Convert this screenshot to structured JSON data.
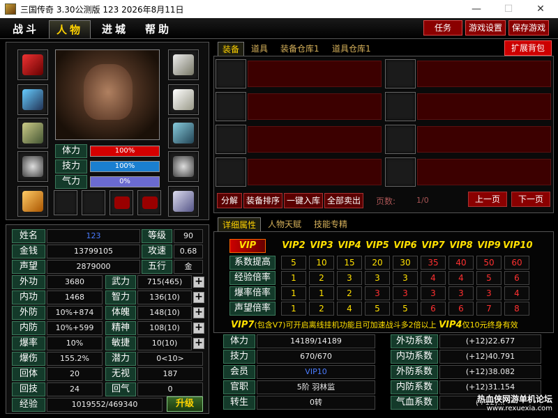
{
  "window": {
    "title": "三国传奇 3.30公测版 123   2026年8月11日",
    "controls": [
      "—",
      "☐",
      "✕"
    ]
  },
  "menu": {
    "tabs": [
      "战斗",
      "人物",
      "进城",
      "帮助"
    ],
    "active": "人物",
    "buttons": {
      "task": "任务",
      "settings": "游戏设置",
      "save": "保存游戏"
    }
  },
  "character": {
    "bars": [
      {
        "label": "体力",
        "value": "100%",
        "fill": 1.0,
        "color": "#d40000"
      },
      {
        "label": "技力",
        "value": "100%",
        "fill": 1.0,
        "color": "#1a7fd0"
      },
      {
        "label": "气力",
        "value": "0%",
        "fill": 0.0,
        "color": "#7a7adc"
      }
    ]
  },
  "stats": {
    "name_label": "姓名",
    "name": "123",
    "level_label": "等级",
    "level": "90",
    "gold_label": "金钱",
    "gold": "13799105",
    "atkspd_label": "攻速",
    "atkspd": "0.68",
    "fame_label": "声望",
    "fame": "2879000",
    "element_label": "五行",
    "element": "金",
    "left": [
      {
        "label": "外功",
        "value": "3680"
      },
      {
        "label": "内功",
        "value": "1468"
      },
      {
        "label": "外防",
        "value": "10%+874"
      },
      {
        "label": "内防",
        "value": "10%+599"
      },
      {
        "label": "爆率",
        "value": "10%"
      },
      {
        "label": "爆伤",
        "value": "155.2%"
      },
      {
        "label": "回体",
        "value": "20"
      },
      {
        "label": "回技",
        "value": "24"
      }
    ],
    "right": [
      {
        "label": "武力",
        "value": "715(465)",
        "plus": true
      },
      {
        "label": "智力",
        "value": "136(10)",
        "plus": true
      },
      {
        "label": "体魄",
        "value": "148(10)",
        "plus": true
      },
      {
        "label": "精神",
        "value": "108(10)",
        "plus": true
      },
      {
        "label": "敏捷",
        "value": "10(10)",
        "plus": true
      },
      {
        "label": "潜力",
        "value": "0<10>",
        "plus": false
      },
      {
        "label": "无视",
        "value": "187",
        "plus": false
      },
      {
        "label": "回气",
        "value": "0",
        "plus": false
      }
    ],
    "exp_label": "经验",
    "exp": "1019552/469340",
    "upgrade": "升级"
  },
  "inventory": {
    "tabs": [
      "装备",
      "道具",
      "装备仓库1",
      "道具仓库1"
    ],
    "active": "装备",
    "expand_btn": "扩展背包",
    "actions": [
      "分解",
      "装备排序",
      "一键入库",
      "全部卖出"
    ],
    "page_label": "页数:",
    "page_value": "1/0",
    "prev": "上一页",
    "next": "下一页"
  },
  "detail": {
    "tabs": [
      "详细属性",
      "人物天赋",
      "技能专精"
    ],
    "active": "详细属性",
    "vip_logo": "VIP",
    "vip_levels": [
      "VIP2",
      "VIP3",
      "VIP4",
      "VIP5",
      "VIP6",
      "VIP7",
      "VIP8",
      "VIP9",
      "VIP10"
    ],
    "vip_rows": [
      {
        "label": "系数提高",
        "values": [
          "5",
          "10",
          "15",
          "20",
          "30",
          "35",
          "40",
          "50",
          "60"
        ]
      },
      {
        "label": "经验倍率",
        "values": [
          "1",
          "2",
          "3",
          "3",
          "3",
          "4",
          "4",
          "5",
          "6"
        ]
      },
      {
        "label": "爆率倍率",
        "values": [
          "1",
          "1",
          "2",
          "3",
          "3",
          "3",
          "3",
          "3",
          "4"
        ]
      },
      {
        "label": "声望倍率",
        "values": [
          "1",
          "2",
          "4",
          "5",
          "5",
          "6",
          "6",
          "7",
          "8"
        ]
      }
    ],
    "vip_note_a": "VIP7",
    "vip_note_b": "(包含V7)可开启离线挂机功能且可加速战斗多2倍以上",
    "vip_note_c": "VIP4",
    "vip_note_d": "仅10元终身有效",
    "left": [
      {
        "label": "体力",
        "value": "14189/14189"
      },
      {
        "label": "技力",
        "value": "670/670"
      },
      {
        "label": "会员",
        "value": "VIP10"
      },
      {
        "label": "官职",
        "value": "5阶 羽林监"
      },
      {
        "label": "转生",
        "value": "0转"
      }
    ],
    "right": [
      {
        "label": "外功系数",
        "value": "(+12)22.677"
      },
      {
        "label": "内功系数",
        "value": "(+12)40.791"
      },
      {
        "label": "外防系数",
        "value": "(+12)38.082"
      },
      {
        "label": "内防系数",
        "value": "(+12)31.154"
      },
      {
        "label": "气血系数",
        "value": "(+12)..."
      }
    ]
  },
  "watermark": {
    "line1": "热血侠网游单机论坛",
    "line2": "www.rexuexia.com"
  }
}
